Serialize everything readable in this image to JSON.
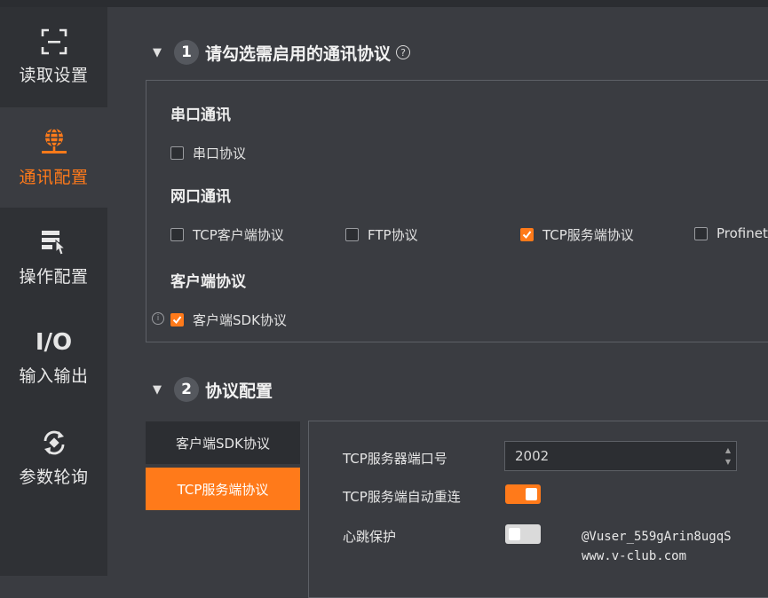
{
  "sidebar": {
    "items": [
      {
        "label": "读取设置",
        "icon": "scan-frame-icon",
        "active": false
      },
      {
        "label": "通讯配置",
        "icon": "network-globe-icon",
        "active": true
      },
      {
        "label": "操作配置",
        "icon": "operation-config-icon",
        "active": false
      },
      {
        "label": "输入输出",
        "icon": "io-icon",
        "active": false,
        "icon_text": "I/O"
      },
      {
        "label": "参数轮询",
        "icon": "refresh-cycle-icon",
        "active": false
      }
    ]
  },
  "section1": {
    "number": "1",
    "title": "请勾选需启用的通讯协议",
    "groups": {
      "serial": {
        "title": "串口通讯",
        "items": [
          {
            "label": "串口协议",
            "checked": false
          }
        ]
      },
      "network": {
        "title": "网口通讯",
        "items": [
          {
            "label": "TCP客户端协议",
            "checked": false
          },
          {
            "label": "FTP协议",
            "checked": false
          },
          {
            "label": "TCP服务端协议",
            "checked": true
          },
          {
            "label": "Profinet",
            "checked": false
          }
        ]
      },
      "client": {
        "title": "客户端协议",
        "items": [
          {
            "label": "客户端SDK协议",
            "checked": true
          }
        ]
      }
    }
  },
  "section2": {
    "number": "2",
    "title": "协议配置",
    "tabs": [
      {
        "label": "客户端SDK协议",
        "active": false
      },
      {
        "label": "TCP服务端协议",
        "active": true
      }
    ],
    "fields": {
      "port_label": "TCP服务器端口号",
      "port_value": "2002",
      "auto_reconnect_label": "TCP服务端自动重连",
      "auto_reconnect": true,
      "heartbeat_label": "心跳保护",
      "heartbeat": false
    }
  },
  "watermark": {
    "line1": "@Vuser_559gArin8ugqS",
    "line2": "www.v-club.com"
  },
  "colors": {
    "accent": "#ff7a1a",
    "background": "#3a3c41",
    "sidebar": "#2f3135"
  }
}
